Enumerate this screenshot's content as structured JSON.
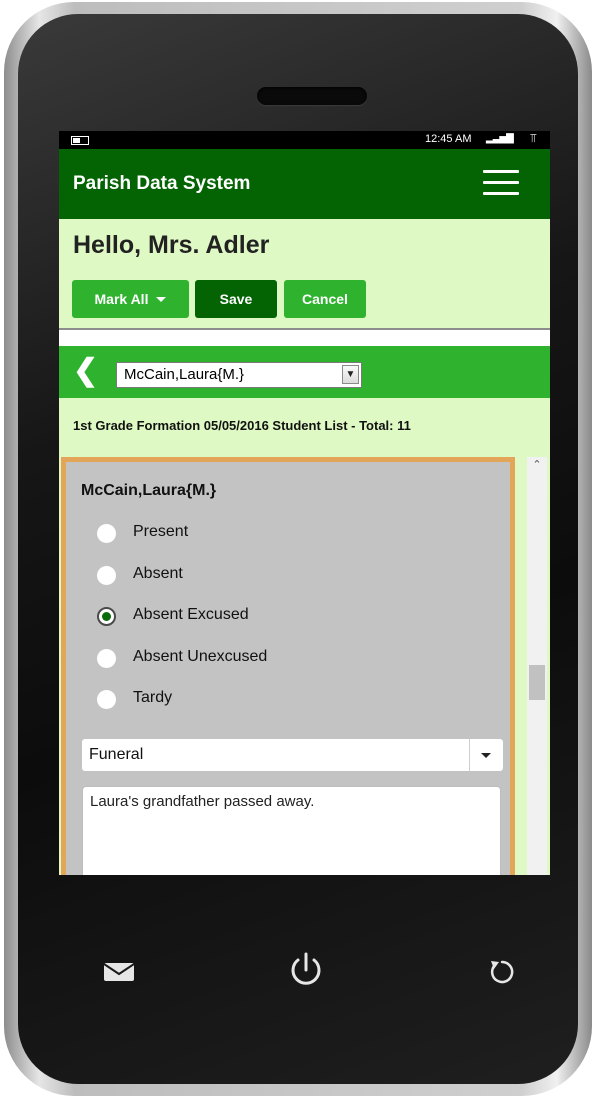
{
  "status_bar": {
    "time": "12:45 AM",
    "signal_icon": "signal-bars-icon",
    "battery_icon": "battery-icon"
  },
  "header": {
    "title": "Parish Data System",
    "menu_icon": "hamburger-menu-icon"
  },
  "greeting": "Hello, Mrs. Adler",
  "actions": {
    "mark_all_label": "Mark All",
    "save_label": "Save",
    "cancel_label": "Cancel"
  },
  "student_nav": {
    "selected_student": "McCain,Laura{M.}"
  },
  "list_info": "1st Grade Formation 05/05/2016 Student List - Total: 11",
  "student_card": {
    "name": "McCain,Laura{M.}",
    "attendance_options": [
      {
        "label": "Present",
        "checked": false
      },
      {
        "label": "Absent",
        "checked": false
      },
      {
        "label": "Absent Excused",
        "checked": true
      },
      {
        "label": "Absent Unexcused",
        "checked": false
      },
      {
        "label": "Tardy",
        "checked": false
      }
    ],
    "reason": "Funeral",
    "notes": "Laura's grandfather passed away."
  },
  "colors": {
    "header": "#046404",
    "accent": "#2fb32f",
    "light_bg": "#dff9c4",
    "card_border": "#e3a659",
    "card_bg": "#c3c3c3"
  }
}
